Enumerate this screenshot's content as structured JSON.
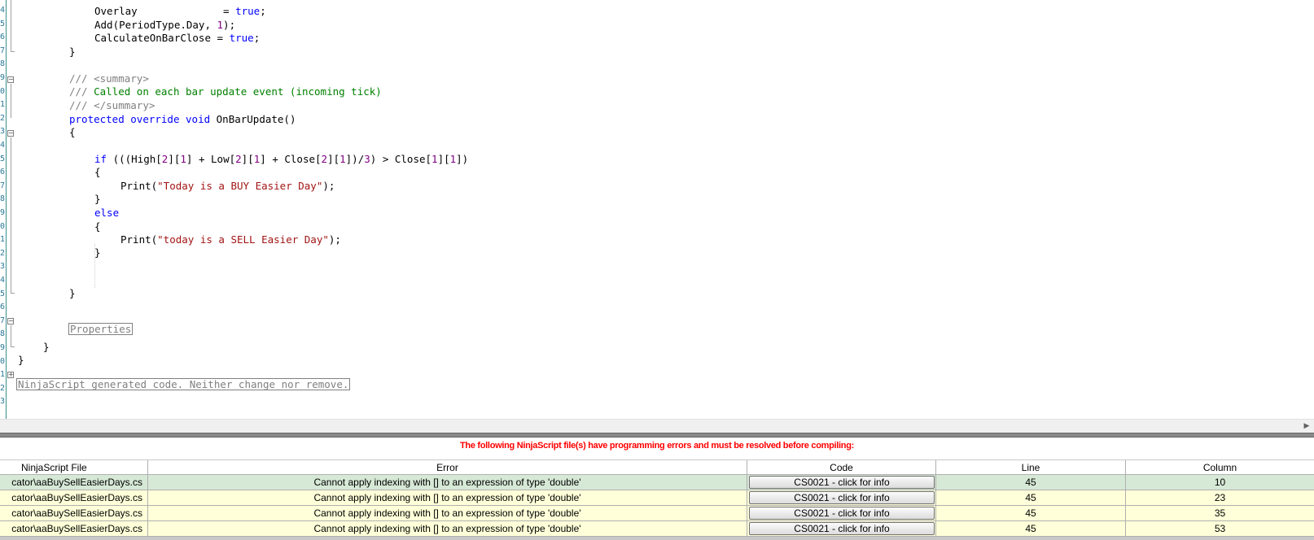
{
  "editor": {
    "line_numbers": [
      "4",
      "5",
      "6",
      "7",
      "8",
      "9",
      "0",
      "1",
      "2",
      "3",
      "4",
      "5",
      "6",
      "7",
      "8",
      "9",
      "0",
      "1",
      "2",
      "3",
      "4",
      "5",
      "6",
      "7",
      "8",
      "9",
      "0",
      "1",
      "2",
      "3"
    ],
    "code": {
      "overlay": "Overlay",
      "overlay_eq": "              = ",
      "true1": "true",
      "semi": ";",
      "add": "Add(PeriodType.Day, ",
      "one": "1",
      "add_end": ");",
      "calc": "CalculateOnBarClose = ",
      "true2": "true",
      "brace_close": "}",
      "brace_open": "{",
      "doc1_prefix": "/// ",
      "doc1_tag": "<summary>",
      "doc2_prefix": "/// ",
      "doc2_text": "Called on each bar update event (incoming tick)",
      "doc3_prefix": "/// ",
      "doc3_tag": "</summary>",
      "kw_protected": "protected",
      "kw_override": "override",
      "kw_void": "void",
      "method": " OnBarUpdate()",
      "kw_if": "if",
      "if_a": " (((High[",
      "n2a": "2",
      "if_b": "][",
      "n1a": "1",
      "if_c": "] + Low[",
      "n2b": "2",
      "if_d": "][",
      "n1b": "1",
      "if_e": "] + Close[",
      "n2c": "2",
      "if_f": "][",
      "n1c": "1",
      "if_g": "])/",
      "n3": "3",
      "if_h": ") > Close[",
      "n1d": "1",
      "if_i": "][",
      "n1e": "1",
      "if_j": "])",
      "print1_a": "Print(",
      "print1_str": "\"Today is a BUY Easier Day\"",
      "print1_b": ");",
      "kw_else": "else",
      "print2_a": "Print(",
      "print2_str": "\"today is a SELL Easier Day\"",
      "print2_b": ");",
      "region_properties": "Properties",
      "region_generated": "NinjaScript generated code. Neither change nor remove."
    }
  },
  "errors": {
    "message": "The following NinjaScript file(s) have programming errors and must be resolved before compiling:",
    "columns": [
      "NinjaScript File",
      "Error",
      "Code",
      "Line",
      "Column"
    ],
    "rows": [
      {
        "file": "cator\\aaBuySellEasierDays.cs",
        "error": "Cannot apply indexing with [] to an expression of type 'double'",
        "code": "CS0021 - click for info",
        "line": "45",
        "column": "10"
      },
      {
        "file": "cator\\aaBuySellEasierDays.cs",
        "error": "Cannot apply indexing with [] to an expression of type 'double'",
        "code": "CS0021 - click for info",
        "line": "45",
        "column": "23"
      },
      {
        "file": "cator\\aaBuySellEasierDays.cs",
        "error": "Cannot apply indexing with [] to an expression of type 'double'",
        "code": "CS0021 - click for info",
        "line": "45",
        "column": "35"
      },
      {
        "file": "cator\\aaBuySellEasierDays.cs",
        "error": "Cannot apply indexing with [] to an expression of type 'double'",
        "code": "CS0021 - click for info",
        "line": "45",
        "column": "53"
      }
    ]
  },
  "colors": {
    "keyword": "#0000ff",
    "number": "#800080",
    "string": "#a31515",
    "comment": "#008000",
    "error_text": "#ff0000",
    "selected_row": "#d6e8d6",
    "error_row": "#ffffd9"
  },
  "icons": [
    "fold-minus-icon",
    "fold-plus-icon",
    "scroll-right-icon"
  ]
}
